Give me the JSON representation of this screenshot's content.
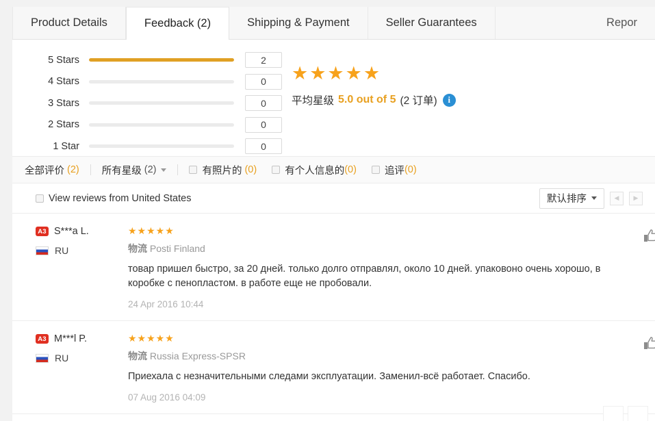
{
  "tabs": [
    {
      "label": "Product Details",
      "active": false
    },
    {
      "label": "Feedback (2)",
      "active": true
    },
    {
      "label": "Shipping & Payment",
      "active": false
    },
    {
      "label": "Seller Guarantees",
      "active": false
    }
  ],
  "report_tab": {
    "label": "Repor"
  },
  "summary": {
    "breakdown": [
      {
        "label": "5 Stars",
        "count": "2",
        "percent": 100
      },
      {
        "label": "4 Stars",
        "count": "0",
        "percent": 0
      },
      {
        "label": "3 Stars",
        "count": "0",
        "percent": 0
      },
      {
        "label": "2 Stars",
        "count": "0",
        "percent": 0
      },
      {
        "label": "1 Star",
        "count": "0",
        "percent": 0
      }
    ],
    "stars_glyphs": "★★★★★",
    "average_label": "平均星级",
    "average_score": "5.0 out of 5",
    "orders_text": "(2 订单)",
    "info_icon_glyph": "i",
    "star_color": "#f7a21c",
    "bar_fill_color": "#e0a024",
    "accent_color": "#e8a020"
  },
  "filters": {
    "all_reviews": {
      "label": "全部评价",
      "count": "(2)"
    },
    "all_stars": {
      "label": "所有星级",
      "count": "(2)"
    },
    "with_photos": {
      "label": "有照片的",
      "count": "(0)"
    },
    "with_personal_info": {
      "label": "有个人信息的",
      "count": "(0)"
    },
    "additional_reviews": {
      "label": "追评",
      "count": "(0)"
    }
  },
  "sort_row": {
    "view_reviews_label": "View reviews from United States",
    "sort_label": "默认排序",
    "prev_glyph": "◀",
    "next_glyph": "▶"
  },
  "reviews": [
    {
      "level_badge": "A3",
      "username": "S***a L.",
      "country_code": "RU",
      "stars": "★★★★★",
      "logistics_label": "物流",
      "logistics_carrier": "Posti Finland",
      "text": "товар пришел быстро, за 20 дней. только долго отправлял, около 10 дней. упаковоно очень хорошо, в коробке с пенопластом. в работе еще не пробовали.",
      "date": "24 Apr 2016 10:44"
    },
    {
      "level_badge": "A3",
      "username": "M***l P.",
      "country_code": "RU",
      "stars": "★★★★★",
      "logistics_label": "物流",
      "logistics_carrier": "Russia Express-SPSR",
      "text": "Приехала с незначительными следами эксплуатации. Заменил-всё работает. Спасибо.",
      "date": "07 Aug 2016 04:09"
    }
  ]
}
